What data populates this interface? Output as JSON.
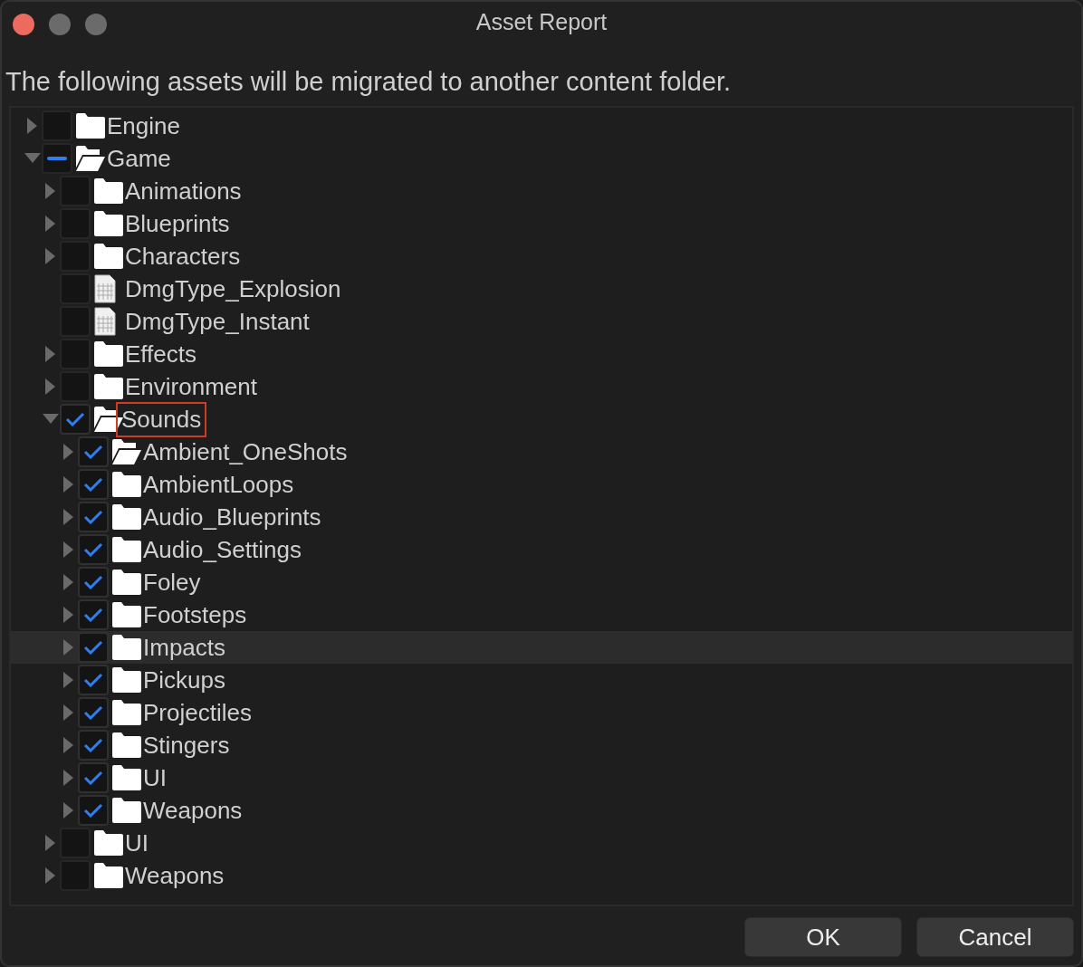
{
  "window": {
    "title": "Asset Report"
  },
  "message": "The following assets will be migrated to another content folder.",
  "tree": [
    {
      "label": "Engine",
      "kind": "folder",
      "expanded": false,
      "checked": false,
      "indeterminate": false,
      "highlighted": false,
      "hovered": false
    },
    {
      "label": "Game",
      "kind": "folder-open",
      "expanded": true,
      "checked": false,
      "indeterminate": true,
      "highlighted": false,
      "hovered": false,
      "children": [
        {
          "label": "Animations",
          "kind": "folder",
          "expanded": false,
          "checked": false,
          "indeterminate": false,
          "highlighted": false,
          "hovered": false
        },
        {
          "label": "Blueprints",
          "kind": "folder",
          "expanded": false,
          "checked": false,
          "indeterminate": false,
          "highlighted": false,
          "hovered": false
        },
        {
          "label": "Characters",
          "kind": "folder",
          "expanded": false,
          "checked": false,
          "indeterminate": false,
          "highlighted": false,
          "hovered": false
        },
        {
          "label": "DmgType_Explosion",
          "kind": "file",
          "checked": false,
          "indeterminate": false,
          "highlighted": false,
          "hovered": false
        },
        {
          "label": "DmgType_Instant",
          "kind": "file",
          "checked": false,
          "indeterminate": false,
          "highlighted": false,
          "hovered": false
        },
        {
          "label": "Effects",
          "kind": "folder",
          "expanded": false,
          "checked": false,
          "indeterminate": false,
          "highlighted": false,
          "hovered": false
        },
        {
          "label": "Environment",
          "kind": "folder",
          "expanded": false,
          "checked": false,
          "indeterminate": false,
          "highlighted": false,
          "hovered": false
        },
        {
          "label": "Sounds",
          "kind": "folder-open",
          "expanded": true,
          "checked": true,
          "indeterminate": false,
          "highlighted": true,
          "hovered": false,
          "children": [
            {
              "label": "Ambient_OneShots",
              "kind": "folder-open",
              "expanded": false,
              "checked": true,
              "indeterminate": false,
              "highlighted": false,
              "hovered": false
            },
            {
              "label": "AmbientLoops",
              "kind": "folder",
              "expanded": false,
              "checked": true,
              "indeterminate": false,
              "highlighted": false,
              "hovered": false
            },
            {
              "label": "Audio_Blueprints",
              "kind": "folder",
              "expanded": false,
              "checked": true,
              "indeterminate": false,
              "highlighted": false,
              "hovered": false
            },
            {
              "label": "Audio_Settings",
              "kind": "folder",
              "expanded": false,
              "checked": true,
              "indeterminate": false,
              "highlighted": false,
              "hovered": false
            },
            {
              "label": "Foley",
              "kind": "folder",
              "expanded": false,
              "checked": true,
              "indeterminate": false,
              "highlighted": false,
              "hovered": false
            },
            {
              "label": "Footsteps",
              "kind": "folder",
              "expanded": false,
              "checked": true,
              "indeterminate": false,
              "highlighted": false,
              "hovered": false
            },
            {
              "label": "Impacts",
              "kind": "folder",
              "expanded": false,
              "checked": true,
              "indeterminate": false,
              "highlighted": false,
              "hovered": true
            },
            {
              "label": "Pickups",
              "kind": "folder",
              "expanded": false,
              "checked": true,
              "indeterminate": false,
              "highlighted": false,
              "hovered": false
            },
            {
              "label": "Projectiles",
              "kind": "folder",
              "expanded": false,
              "checked": true,
              "indeterminate": false,
              "highlighted": false,
              "hovered": false
            },
            {
              "label": "Stingers",
              "kind": "folder",
              "expanded": false,
              "checked": true,
              "indeterminate": false,
              "highlighted": false,
              "hovered": false
            },
            {
              "label": "UI",
              "kind": "folder",
              "expanded": false,
              "checked": true,
              "indeterminate": false,
              "highlighted": false,
              "hovered": false
            },
            {
              "label": "Weapons",
              "kind": "folder",
              "expanded": false,
              "checked": true,
              "indeterminate": false,
              "highlighted": false,
              "hovered": false
            }
          ]
        },
        {
          "label": "UI",
          "kind": "folder",
          "expanded": false,
          "checked": false,
          "indeterminate": false,
          "highlighted": false,
          "hovered": false
        },
        {
          "label": "Weapons",
          "kind": "folder",
          "expanded": false,
          "checked": false,
          "indeterminate": false,
          "highlighted": false,
          "hovered": false
        }
      ]
    }
  ],
  "buttons": [
    "OK",
    "Cancel"
  ]
}
